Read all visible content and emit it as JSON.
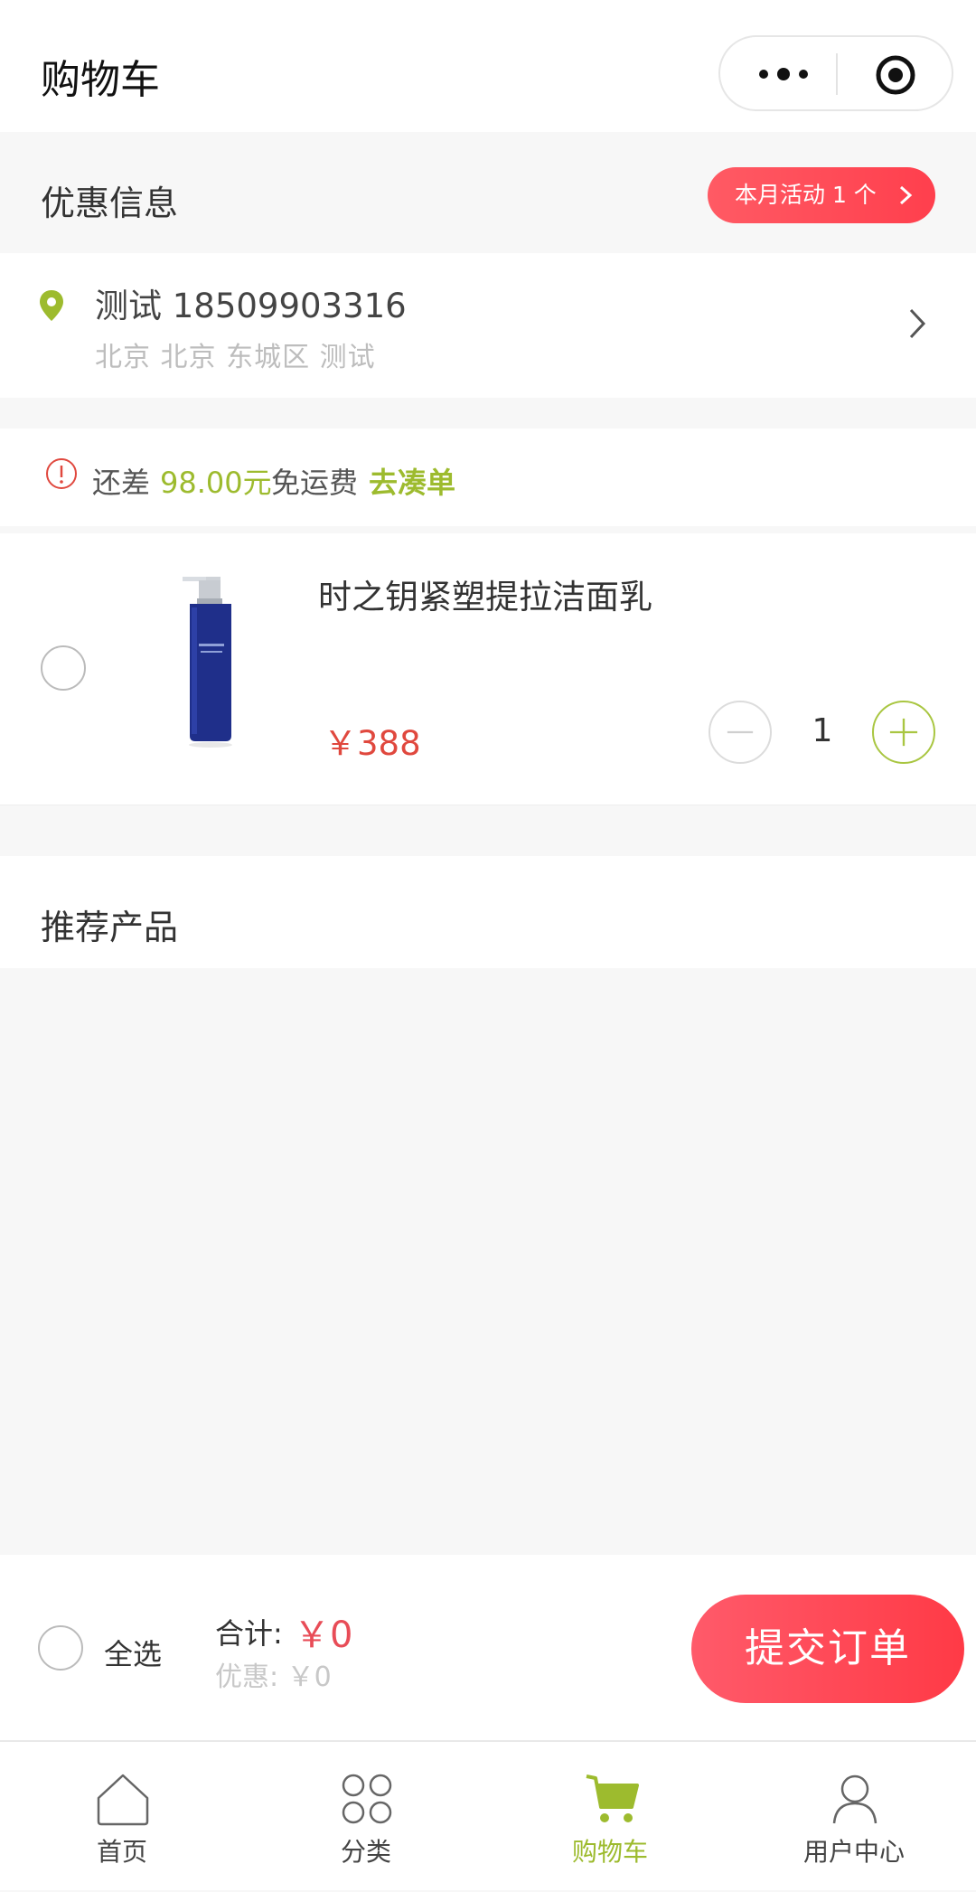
{
  "header": {
    "title": "购物车"
  },
  "promo": {
    "title": "优惠信息",
    "badge": "本月活动 1 个"
  },
  "address": {
    "name_phone": "测试 18509903316",
    "detail": "北京 北京 东城区 测试"
  },
  "shipping": {
    "prefix": "还差",
    "amount": "98.00元",
    "suffix": "免运费",
    "action": "去凑单"
  },
  "cart": {
    "items": [
      {
        "name": "时之钥紧塑提拉洁面乳",
        "price": "￥388",
        "quantity": "1"
      }
    ]
  },
  "recommend": {
    "title": "推荐产品"
  },
  "summary": {
    "select_all": "全选",
    "total_label": "合计:",
    "total_value": "￥0",
    "discount": "优惠: ￥0",
    "submit": "提交订单"
  },
  "tabbar": {
    "items": [
      {
        "label": "首页",
        "icon": "home-icon"
      },
      {
        "label": "分类",
        "icon": "category-icon"
      },
      {
        "label": "购物车",
        "icon": "cart-icon",
        "active": true
      },
      {
        "label": "用户中心",
        "icon": "user-icon"
      }
    ]
  },
  "colors": {
    "accent_green": "#9dbb2e",
    "price_red": "#e0483e",
    "button_red": "#ff3f4d"
  }
}
